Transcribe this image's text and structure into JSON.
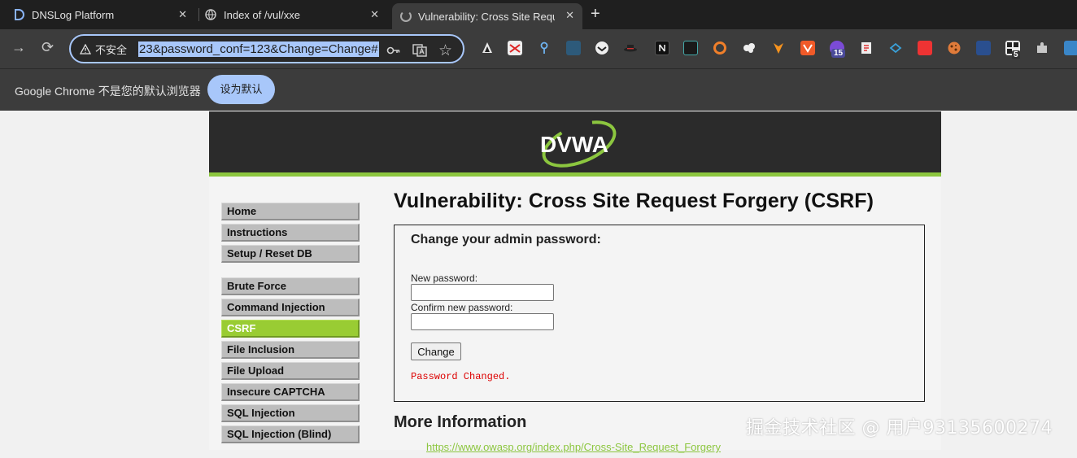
{
  "tabs": [
    {
      "title": "DNSLog Platform",
      "close": "✕"
    },
    {
      "title": "Index of /vul/xxe",
      "close": "✕"
    }
  ],
  "active_tab": {
    "title": "Vulnerability: Cross Site Requ",
    "close": "✕"
  },
  "new_tab": "+",
  "toolbar": {
    "forward": "→",
    "reload": "⟳",
    "security_label": "不安全",
    "url_visible": "23&password_conf=123&Change=Change#",
    "bookmark_star": "☆"
  },
  "extensions": {
    "badge_1": "15",
    "badge_2": "5"
  },
  "infobar": {
    "message": "Google Chrome 不是您的默认浏览器",
    "button": "设为默认"
  },
  "colors": {
    "dvwa_green": "#8cc63f",
    "menu_selected": "#99cc33",
    "header_bg": "#2b2b2b",
    "error_red": "#dd0000"
  },
  "dvwa": {
    "logo_text": "DVWA",
    "menu_group_1": [
      "Home",
      "Instructions",
      "Setup / Reset DB"
    ],
    "menu_group_2": [
      "Brute Force",
      "Command Injection",
      "CSRF",
      "File Inclusion",
      "File Upload",
      "Insecure CAPTCHA",
      "SQL Injection",
      "SQL Injection (Blind)"
    ],
    "selected_menu": "CSRF",
    "title": "Vulnerability: Cross Site Request Forgery (CSRF)",
    "form": {
      "heading": "Change your admin password:",
      "new_password_label": "New password:",
      "confirm_password_label": "Confirm new password:",
      "new_password_value": "",
      "confirm_password_value": "",
      "submit_label": "Change",
      "result_message": "Password Changed."
    },
    "more_info_heading": "More Information",
    "more_info_link": "https://www.owasp.org/index.php/Cross-Site_Request_Forgery"
  },
  "watermark": "掘金技术社区 @ 用户93135600274"
}
